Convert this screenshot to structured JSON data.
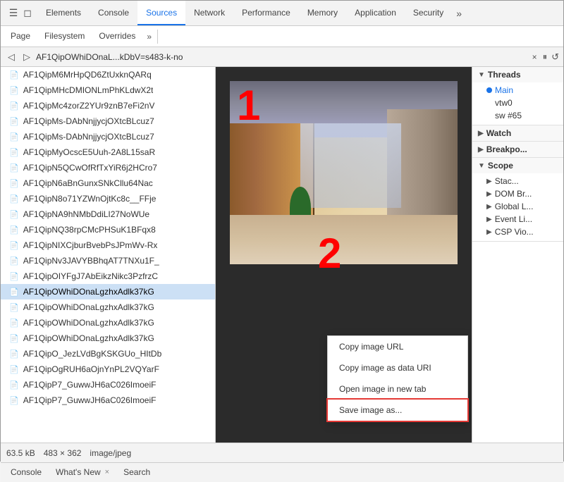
{
  "toolbar": {
    "icons": [
      "☰",
      "◻"
    ],
    "tabs": [
      {
        "label": "Elements",
        "active": false
      },
      {
        "label": "Console",
        "active": false
      },
      {
        "label": "Sources",
        "active": true
      },
      {
        "label": "Network",
        "active": false
      },
      {
        "label": "Performance",
        "active": false
      },
      {
        "label": "Memory",
        "active": false
      },
      {
        "label": "Application",
        "active": false
      },
      {
        "label": "Security",
        "active": false
      }
    ],
    "more_label": "»"
  },
  "subtabs": [
    {
      "label": "Page",
      "active": false
    },
    {
      "label": "Filesystem",
      "active": false
    },
    {
      "label": "Overrides",
      "active": false
    },
    {
      "label": "»",
      "active": false
    }
  ],
  "url_bar": {
    "filename": "AF1QipOWhiDOnaL...kDbV=s483-k-no",
    "close": "×"
  },
  "file_list": [
    "AF1QipM6MrHpQD6ZtUxknQARq",
    "AF1QipMHcDMIONLmPhKLdwX2t",
    "AF1QipMc4zorZ2YUr9znB7eFi2nV",
    "AF1QipMs-DAbNnjjycjOXtcBLcuz7",
    "AF1QipMs-DAbNnjjycjOXtcBLcuz7",
    "AF1QipMyOcscE5Uuh-2A8L15saR",
    "AF1QipN5QCwOfRfTxYiR6j2HCro7",
    "AF1QipN6aBnGunxSNkCllu64Nac",
    "AF1QipN8o71YZWnOjtKc8c__FFje",
    "AF1QipNA9hNMbDdiLI27NoWUe",
    "AF1QipNQ38rpCMcPHSuK1BFqx8",
    "AF1QipNIXCjburBvebPsJPmWv-Rx",
    "AF1QipNv3JAVYBBhqAT7TNXu1F_",
    "AF1QipOIYFgJ7AbEikzNikc3PzfrzC",
    "AF1QipOWhiDOnaLgzhxAdlk37kG",
    "AF1QipOWhiDOnaLgzhxAdlk37kG",
    "AF1QipOWhiDOnaLgzhxAdlk37kG",
    "AF1QipOWhiDOnaLgzhxAdlk37kG",
    "AF1QipO_JezLVdBgKSKGUo_HItDb",
    "AF1QipOgRUH6aOjnYnPL2VQYarF",
    "AF1QipP7_GuwwJH6aC026ImoeiF",
    "AF1QipP7_GuwwJH6aC026ImoeiF"
  ],
  "selected_file_index": 14,
  "right_panel": {
    "pause_btn": "⏸",
    "refresh_btn": "↺",
    "threads_section": {
      "label": "Threads",
      "items": [
        {
          "label": "Main",
          "active": true,
          "has_dot": true
        },
        {
          "label": "vtw0",
          "active": false
        },
        {
          "label": "sw #65",
          "active": false
        }
      ]
    },
    "watch_section": {
      "label": "Watch"
    },
    "breakpoints_section": {
      "label": "Breakpo..."
    },
    "scope_section": {
      "label": "Scope",
      "items": [
        {
          "label": "Stac...",
          "has_arrow": true
        },
        {
          "label": "DOM Br...",
          "has_arrow": true
        },
        {
          "label": "Global L...",
          "has_arrow": true
        },
        {
          "label": "Event Li...",
          "has_arrow": true
        },
        {
          "label": "CSP Vio...",
          "has_arrow": true
        }
      ]
    }
  },
  "context_menu": {
    "items": [
      {
        "label": "Copy image URL"
      },
      {
        "label": "Copy image as data URI"
      },
      {
        "label": "Open image in new tab"
      },
      {
        "label": "Save image as...",
        "highlighted": true
      }
    ]
  },
  "status_bar": {
    "size": "63.5 kB",
    "dims": "483 × 362",
    "type": "image/jpeg"
  },
  "bottom_tabs": [
    {
      "label": "Console",
      "closable": false
    },
    {
      "label": "What's New",
      "closable": true
    },
    {
      "label": "Search",
      "closable": false
    }
  ]
}
